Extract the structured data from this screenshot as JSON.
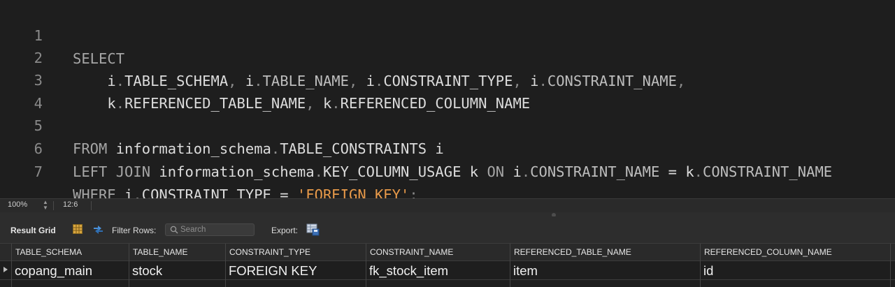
{
  "editor": {
    "lines": [
      {
        "num": "1",
        "tokens": [
          {
            "t": "SELECT",
            "c": "kw"
          }
        ]
      },
      {
        "num": "2",
        "tokens": [
          {
            "t": "    i",
            "c": "id"
          },
          {
            "t": ".",
            "c": "p"
          },
          {
            "t": "TABLE_SCHEMA",
            "c": "id"
          },
          {
            "t": ", ",
            "c": "p"
          },
          {
            "t": "i",
            "c": "id"
          },
          {
            "t": ".",
            "c": "p"
          },
          {
            "t": "TABLE_NAME",
            "c": "hl"
          },
          {
            "t": ", ",
            "c": "p"
          },
          {
            "t": "i",
            "c": "id"
          },
          {
            "t": ".",
            "c": "p"
          },
          {
            "t": "CONSTRAINT_TYPE",
            "c": "id"
          },
          {
            "t": ", ",
            "c": "p"
          },
          {
            "t": "i",
            "c": "id"
          },
          {
            "t": ".",
            "c": "p"
          },
          {
            "t": "CONSTRAINT_NAME",
            "c": "hl"
          },
          {
            "t": ",",
            "c": "p"
          }
        ]
      },
      {
        "num": "3",
        "tokens": [
          {
            "t": "    k",
            "c": "id"
          },
          {
            "t": ".",
            "c": "p"
          },
          {
            "t": "REFERENCED_TABLE_NAME",
            "c": "id"
          },
          {
            "t": ", ",
            "c": "p"
          },
          {
            "t": "k",
            "c": "id"
          },
          {
            "t": ".",
            "c": "p"
          },
          {
            "t": "REFERENCED_COLUMN_NAME",
            "c": "id"
          }
        ]
      },
      {
        "num": "4",
        "tokens": []
      },
      {
        "num": "5",
        "tokens": [
          {
            "t": "FROM",
            "c": "kw"
          },
          {
            "t": " information_schema",
            "c": "id"
          },
          {
            "t": ".",
            "c": "p"
          },
          {
            "t": "TABLE_CONSTRAINTS i",
            "c": "id"
          }
        ]
      },
      {
        "num": "6",
        "tokens": [
          {
            "t": "LEFT JOIN",
            "c": "kw"
          },
          {
            "t": " information_schema",
            "c": "id"
          },
          {
            "t": ".",
            "c": "p"
          },
          {
            "t": "KEY_COLUMN_USAGE k ",
            "c": "id"
          },
          {
            "t": "ON",
            "c": "kw"
          },
          {
            "t": " i",
            "c": "id"
          },
          {
            "t": ".",
            "c": "p"
          },
          {
            "t": "CONSTRAINT_NAME",
            "c": "hl"
          },
          {
            "t": " = ",
            "c": "id"
          },
          {
            "t": "k",
            "c": "id"
          },
          {
            "t": ".",
            "c": "p"
          },
          {
            "t": "CONSTRAINT_NAME",
            "c": "hl"
          }
        ]
      },
      {
        "num": "7",
        "tokens": [
          {
            "t": "WHERE",
            "c": "kw"
          },
          {
            "t": " i",
            "c": "id"
          },
          {
            "t": ".",
            "c": "p"
          },
          {
            "t": "CONSTRAINT_TYPE = ",
            "c": "id"
          },
          {
            "t": "'FOREIGN KEY'",
            "c": "str"
          },
          {
            "t": ";",
            "c": "p"
          }
        ]
      }
    ]
  },
  "status": {
    "zoom": "100%",
    "cursor": "12:6"
  },
  "toolbar": {
    "result_grid_label": "Result Grid",
    "filter_label": "Filter Rows:",
    "search_placeholder": "Search",
    "search_value": "",
    "export_label": "Export:"
  },
  "grid": {
    "columns": [
      "TABLE_SCHEMA",
      "TABLE_NAME",
      "CONSTRAINT_TYPE",
      "CONSTRAINT_NAME",
      "REFERENCED_TABLE_NAME",
      "REFERENCED_COLUMN_NAME"
    ],
    "rows": [
      [
        "copang_main",
        "stock",
        "FOREIGN KEY",
        "fk_stock_item",
        "item",
        "id"
      ]
    ]
  },
  "icons": {
    "grid": "grid-icon",
    "refresh": "refresh-icon",
    "search": "search-icon",
    "export": "export-icon"
  },
  "colors": {
    "keyword": "#a6a6a6",
    "string": "#e89a4a",
    "background": "#1e1e1e"
  }
}
